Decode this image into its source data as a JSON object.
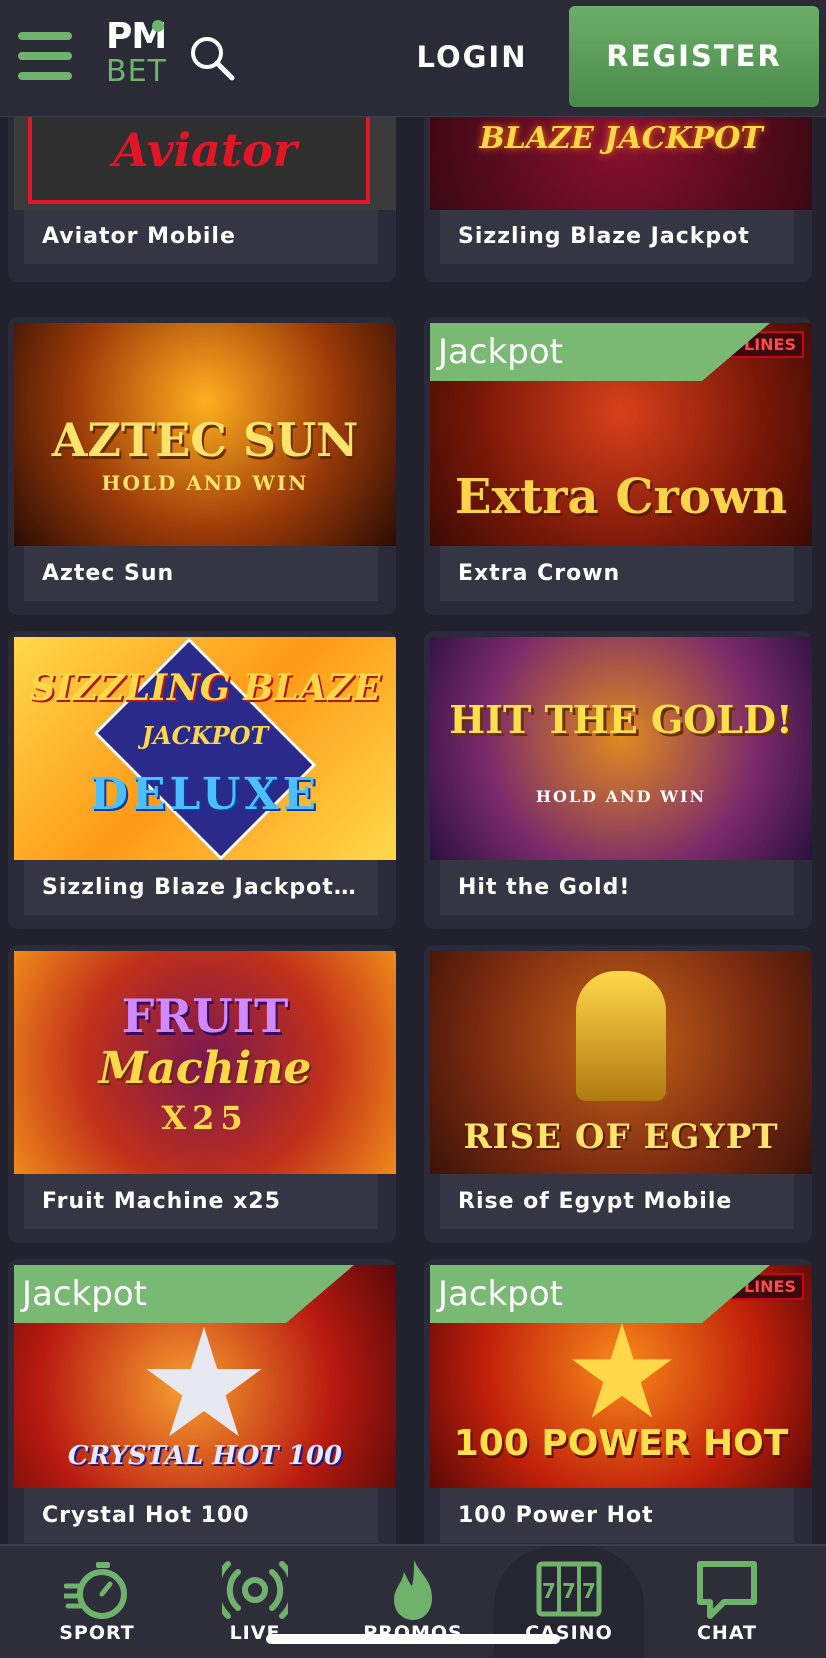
{
  "header": {
    "logo_top": "PM",
    "logo_bottom": "BET",
    "login_label": "LOGIN",
    "register_label": "REGISTER"
  },
  "icons": [
    "menu-icon",
    "search-icon",
    "stopwatch-icon",
    "live-signal-icon",
    "flame-icon",
    "slot-machine-icon",
    "chat-bubble-icon"
  ],
  "colors": {
    "accent": "#6fb26c",
    "background": "#22222e",
    "header": "#2b2b38",
    "jackpot_badge": "#79b973"
  },
  "games": [
    {
      "name": "Aviator Mobile",
      "art": "Aviator",
      "badge": ""
    },
    {
      "name": "Sizzling Blaze Jackpot",
      "art": "BLAZE JACKPOT",
      "badge": ""
    },
    {
      "name": "Aztec Sun",
      "art": "AZTEC SUN",
      "art2": "HOLD AND WIN",
      "badge": ""
    },
    {
      "name": "Extra Crown",
      "art": "Extra Crown",
      "badge": "Jackpot",
      "lines": "40 LINES"
    },
    {
      "name": "Sizzling Blaze Jackpot…",
      "art": "SIZZLING BLAZE",
      "art2": "JACKPOT",
      "art3": "DELUXE",
      "badge": ""
    },
    {
      "name": "Hit the Gold!",
      "art": "HIT THE GOLD!",
      "art2": "HOLD AND WIN",
      "badge": ""
    },
    {
      "name": "Fruit Machine x25",
      "art": "FRUIT",
      "art2": "Machine",
      "art3": "X25",
      "badge": ""
    },
    {
      "name": "Rise of Egypt Mobile",
      "art": "RISE OF EGYPT",
      "badge": ""
    },
    {
      "name": "Crystal Hot 100",
      "art": "CRYSTAL HOT 100",
      "badge": "Jackpot"
    },
    {
      "name": "100 Power Hot",
      "art": "100 POWER HOT",
      "badge": "Jackpot",
      "lines": "100 LINES"
    }
  ],
  "bottom_nav": [
    {
      "label": "SPORT",
      "icon": "stopwatch-icon"
    },
    {
      "label": "LIVE",
      "icon": "live-signal-icon"
    },
    {
      "label": "PROMOS",
      "icon": "flame-icon"
    },
    {
      "label": "CASINO",
      "icon": "slot-machine-icon",
      "active": true
    },
    {
      "label": "CHAT",
      "icon": "chat-bubble-icon"
    }
  ]
}
